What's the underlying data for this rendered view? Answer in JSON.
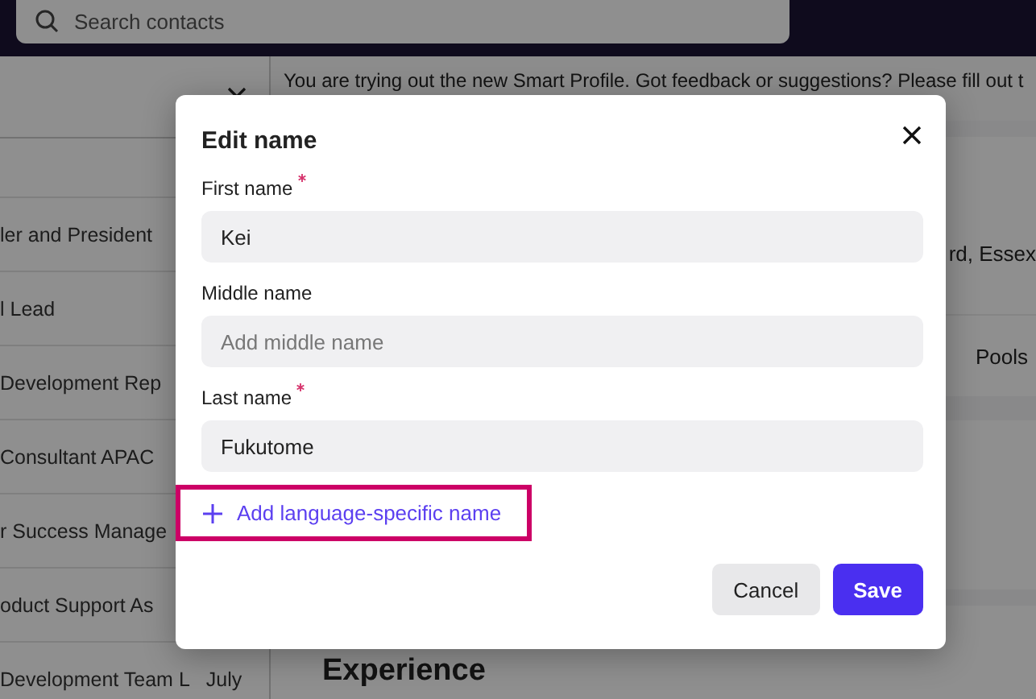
{
  "top_bar": {
    "search": {
      "placeholder": "Search contacts"
    }
  },
  "side_panel": {
    "rows": [
      "ler and President",
      "l Lead",
      "Development Rep",
      "Consultant APAC",
      "r Success Manage",
      "oduct Support As",
      "Development Team L"
    ],
    "last_row_extra": "July"
  },
  "banner": {
    "text": "You are trying out the new Smart Profile. Got feedback or suggestions? Please fill out t"
  },
  "profile": {
    "location": "rd, Essex",
    "tab": "Pools",
    "section_title": "Experience"
  },
  "dialog": {
    "title": "Edit name",
    "fields": [
      {
        "label": "First name",
        "required": true,
        "value": "Kei"
      },
      {
        "label": "Middle name",
        "required": false,
        "placeholder": "Add middle name"
      },
      {
        "label": "Last name",
        "required": true,
        "value": "Fukutome"
      }
    ],
    "link": {
      "label": "Add language-specific name",
      "highlighted": true
    },
    "buttons": [
      {
        "label": "Cancel",
        "kind": "secondary"
      },
      {
        "label": "Save",
        "kind": "primary"
      }
    ]
  }
}
